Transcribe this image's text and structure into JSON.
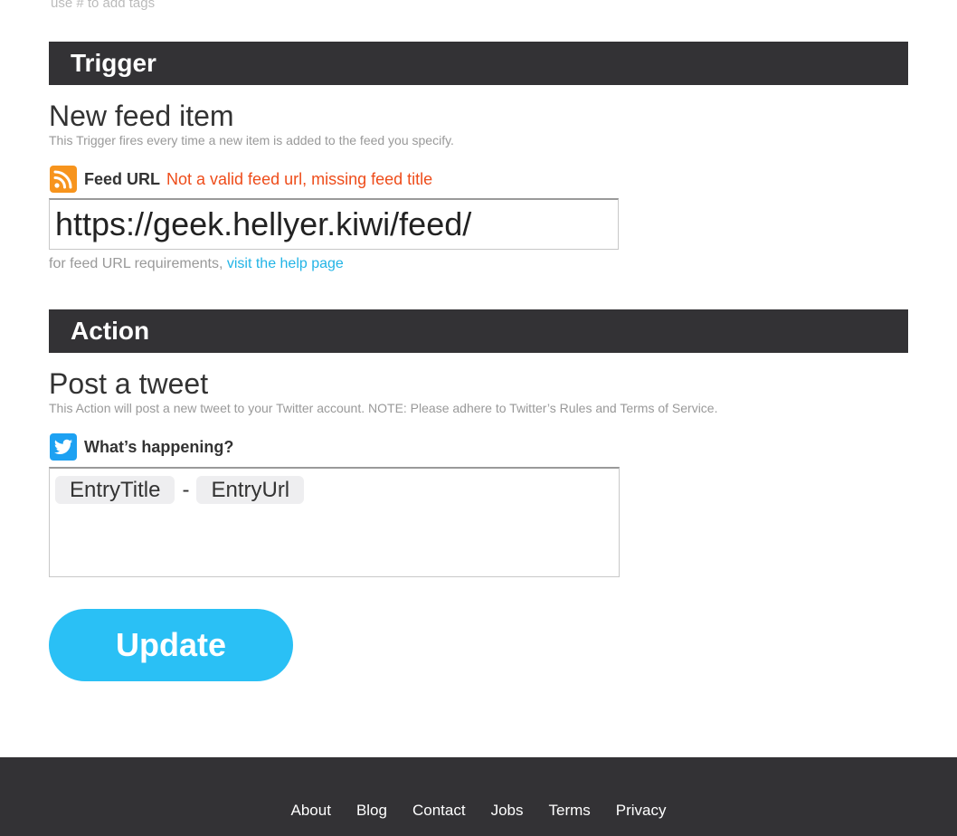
{
  "top_hint": {
    "text": "use  #  to add tags"
  },
  "trigger": {
    "section_label": "Trigger",
    "title": "New feed item",
    "description": "This Trigger fires every time a new item is added to the feed you specify.",
    "field": {
      "icon": "rss-icon",
      "label": "Feed URL",
      "error": "Not a valid feed url, missing feed title",
      "value": "https://geek.hellyer.kiwi/feed/"
    },
    "help_prefix": "for feed URL requirements,",
    "help_link": "visit the help page"
  },
  "action": {
    "section_label": "Action",
    "title": "Post a tweet",
    "description": "This Action will post a new tweet to your Twitter account. NOTE: Please adhere to Twitter’s Rules and Terms of Service.",
    "field": {
      "icon": "twitter-icon",
      "label": "What’s happening?",
      "ingredients": [
        "EntryTitle",
        "EntryUrl"
      ],
      "separator": "-"
    }
  },
  "update_button": {
    "label": "Update"
  },
  "footer": {
    "links": [
      "About",
      "Blog",
      "Contact",
      "Jobs",
      "Terms",
      "Privacy"
    ]
  },
  "colors": {
    "section_bar": "#333235",
    "error": "#ee4c1a",
    "link": "#22b4e6",
    "button": "#2ac0f5",
    "rss": "#f7941d",
    "twitter": "#1da1f2"
  }
}
